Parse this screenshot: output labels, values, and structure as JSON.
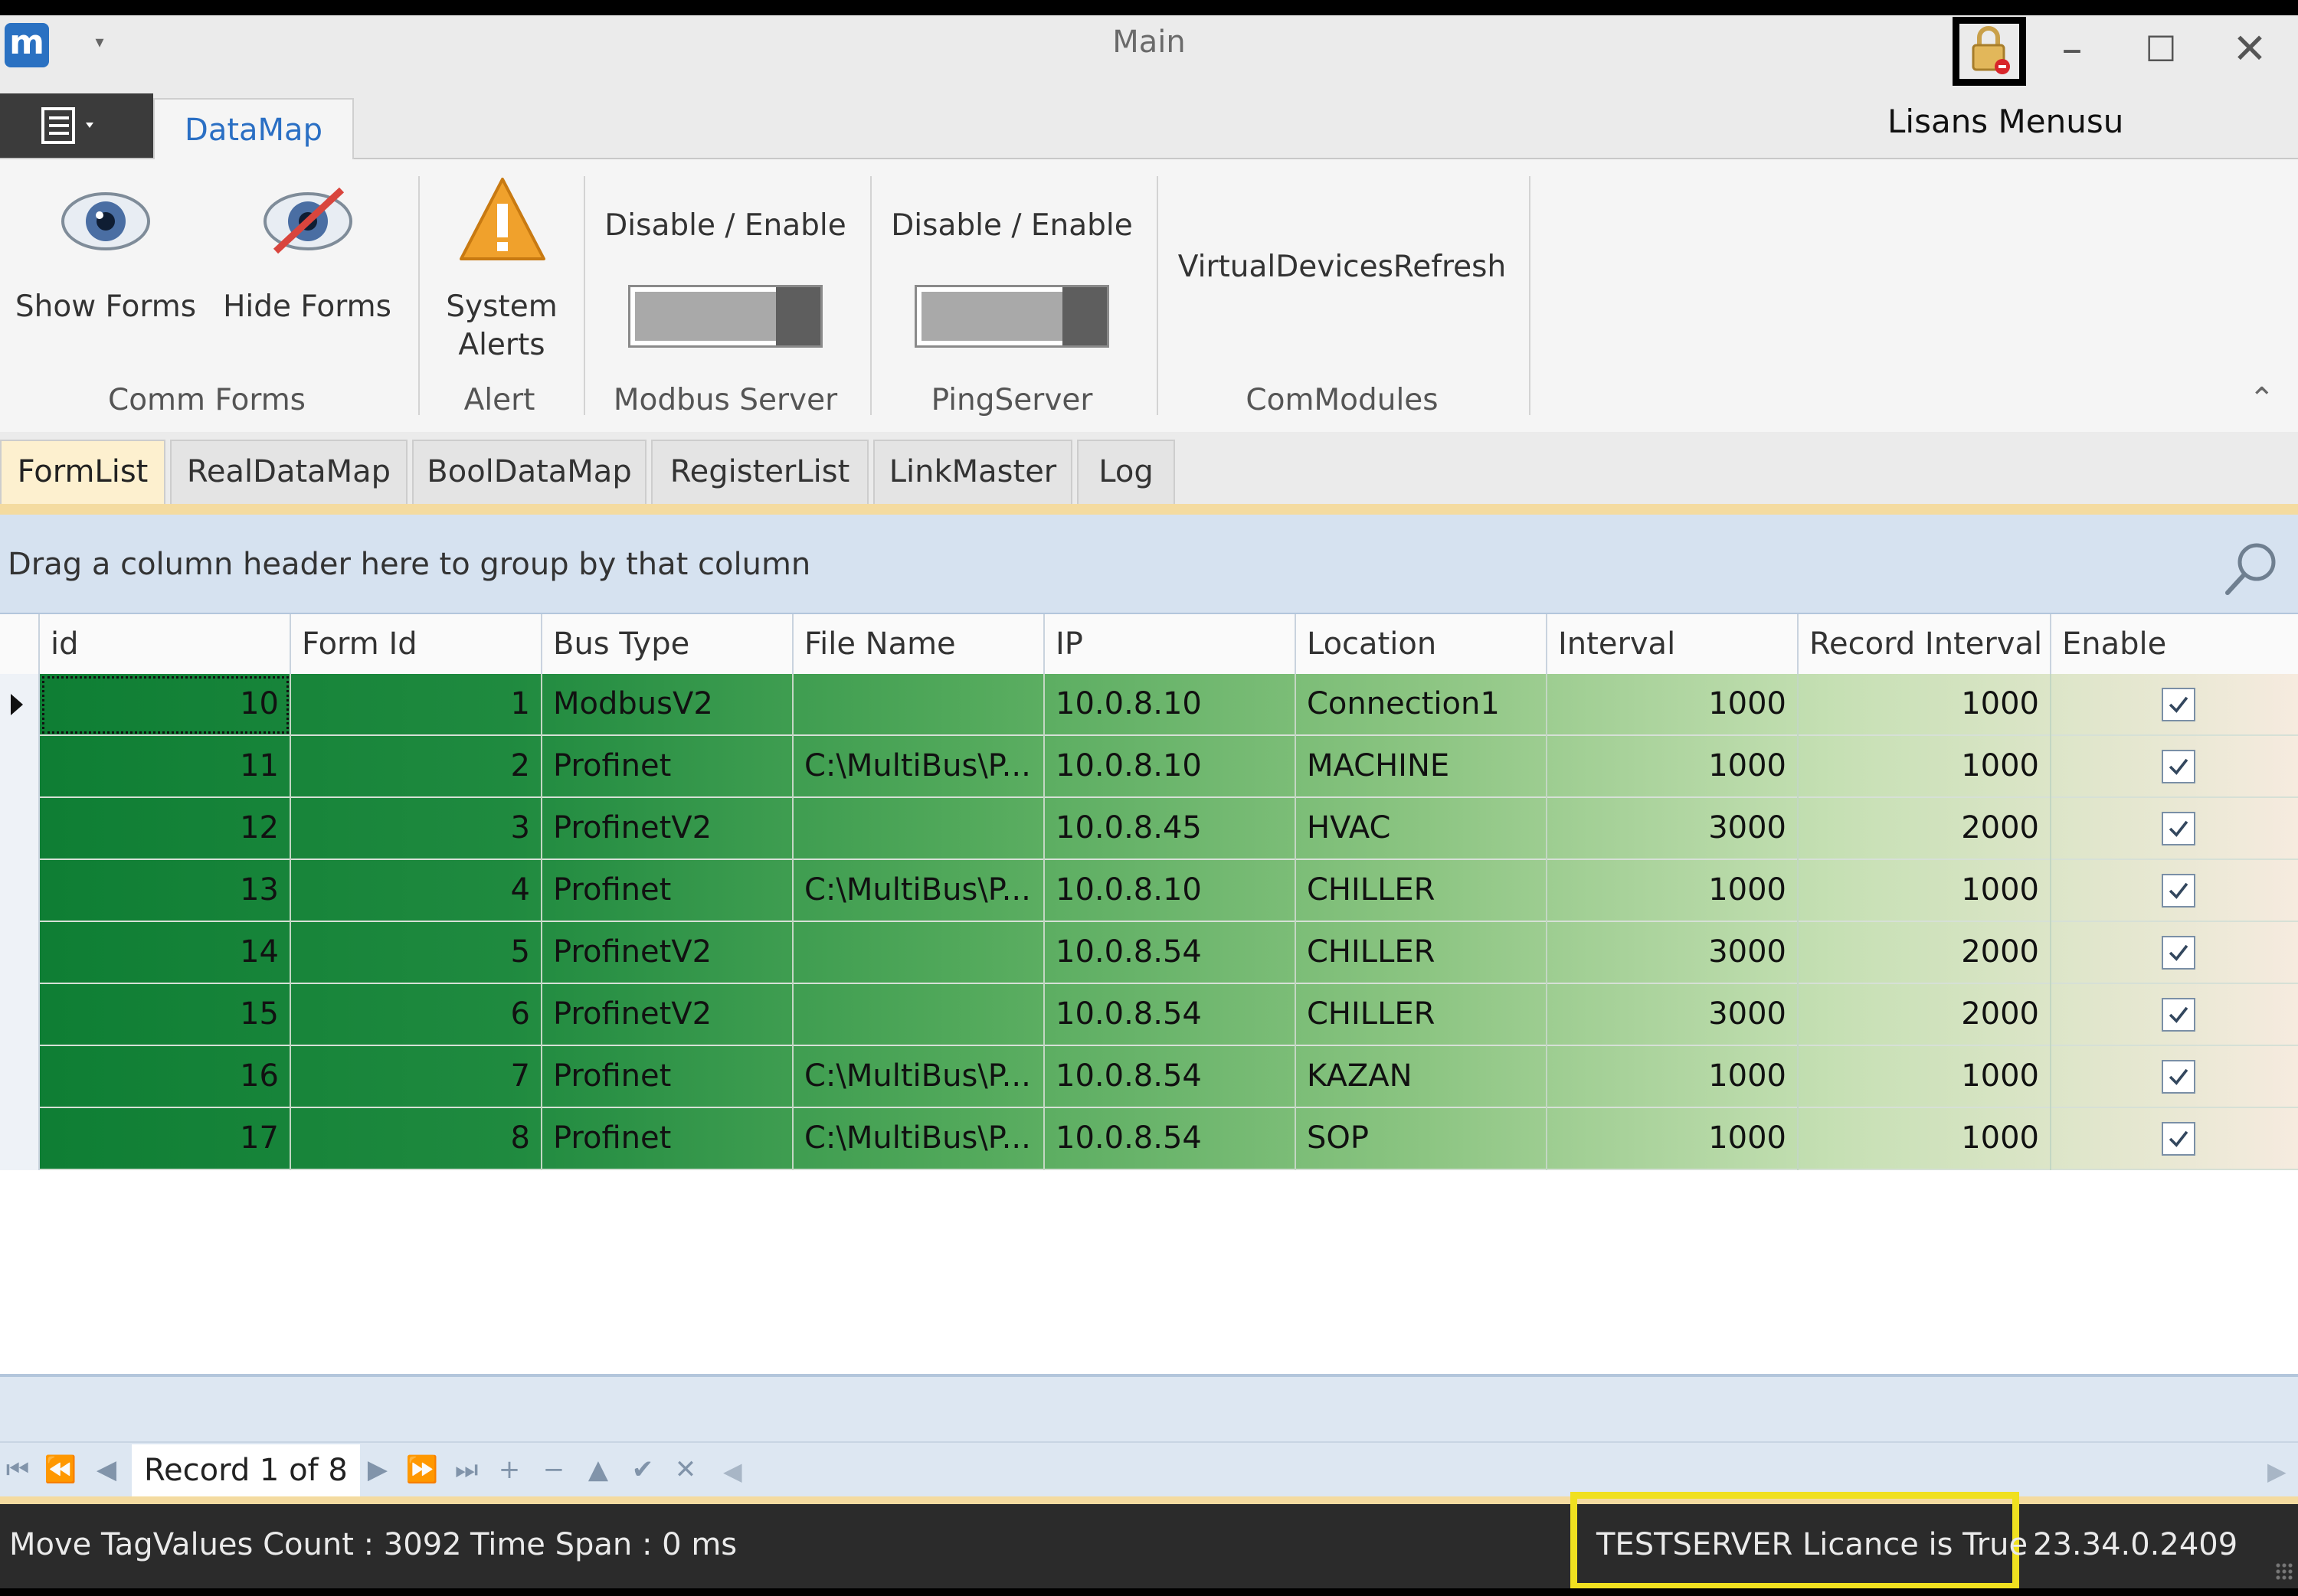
{
  "window": {
    "title": "Main",
    "app_logo_letter": "m",
    "buttons": {
      "minimize": "–",
      "maximize": "☐",
      "close": "✕"
    }
  },
  "ribbon": {
    "tab": "DataMap",
    "license_menu_label": "Lisans Menusu",
    "show_forms": "Show Forms",
    "hide_forms": "Hide Forms",
    "system_alerts_line1": "System",
    "system_alerts_line2": "Alerts",
    "modbus_toggle_label": "Disable / Enable",
    "ping_toggle_label": "Disable / Enable",
    "virtual_devices_refresh": "VirtualDevicesRefresh",
    "groups": {
      "comm_forms": "Comm Forms",
      "alert": "Alert",
      "modbus_server": "Modbus Server",
      "ping_server": "PingServer",
      "com_modules": "ComModules"
    }
  },
  "doc_tabs": [
    "FormList",
    "RealDataMap",
    "BoolDataMap",
    "RegisterList",
    "LinkMaster",
    "Log"
  ],
  "group_panel_text": "Drag a column header here to group by that column",
  "grid": {
    "columns": [
      "id",
      "Form Id",
      "Bus Type",
      "File Name",
      "IP",
      "Location",
      "Interval",
      "Record Interval",
      "Enable"
    ],
    "rows": [
      {
        "id": "10",
        "form_id": "1",
        "bus_type": "ModbusV2",
        "file_name": "",
        "ip": "10.0.8.10",
        "location": "Connection1",
        "interval": "1000",
        "record_interval": "1000",
        "enable": true
      },
      {
        "id": "11",
        "form_id": "2",
        "bus_type": "Profinet",
        "file_name": "C:\\MultiBus\\P...",
        "ip": "10.0.8.10",
        "location": "MACHINE",
        "interval": "1000",
        "record_interval": "1000",
        "enable": true
      },
      {
        "id": "12",
        "form_id": "3",
        "bus_type": "ProfinetV2",
        "file_name": "",
        "ip": "10.0.8.45",
        "location": "HVAC",
        "interval": "3000",
        "record_interval": "2000",
        "enable": true
      },
      {
        "id": "13",
        "form_id": "4",
        "bus_type": "Profinet",
        "file_name": "C:\\MultiBus\\P...",
        "ip": "10.0.8.10",
        "location": "CHILLER",
        "interval": "1000",
        "record_interval": "1000",
        "enable": true
      },
      {
        "id": "14",
        "form_id": "5",
        "bus_type": "ProfinetV2",
        "file_name": "",
        "ip": "10.0.8.54",
        "location": "CHILLER",
        "interval": "3000",
        "record_interval": "2000",
        "enable": true
      },
      {
        "id": "15",
        "form_id": "6",
        "bus_type": "ProfinetV2",
        "file_name": "",
        "ip": "10.0.8.54",
        "location": "CHILLER",
        "interval": "3000",
        "record_interval": "2000",
        "enable": true
      },
      {
        "id": "16",
        "form_id": "7",
        "bus_type": "Profinet",
        "file_name": "C:\\MultiBus\\P...",
        "ip": "10.0.8.54",
        "location": "KAZAN",
        "interval": "1000",
        "record_interval": "1000",
        "enable": true
      },
      {
        "id": "17",
        "form_id": "8",
        "bus_type": "Profinet",
        "file_name": "C:\\MultiBus\\P...",
        "ip": "10.0.8.54",
        "location": "SOP",
        "interval": "1000",
        "record_interval": "1000",
        "enable": true
      }
    ]
  },
  "navigator": {
    "record_text": "Record 1 of 8",
    "buttons": [
      "⏮",
      "⏪",
      "◀",
      "▶",
      "⏩",
      "⏭",
      "+",
      "−",
      "▲",
      "✔",
      "✕"
    ]
  },
  "status": {
    "move_count": "Move TagValues Count : 3092",
    "time_span": "Time Span :  0 ms",
    "licence": "TESTSERVER Licance is True",
    "version": "23.34.0.2409"
  },
  "colors": {
    "accent": "#2a6fc4",
    "grid_green_dark": "#0d7d33",
    "highlight_yellow": "#f0e020",
    "tab_accent": "#f4dba0"
  }
}
